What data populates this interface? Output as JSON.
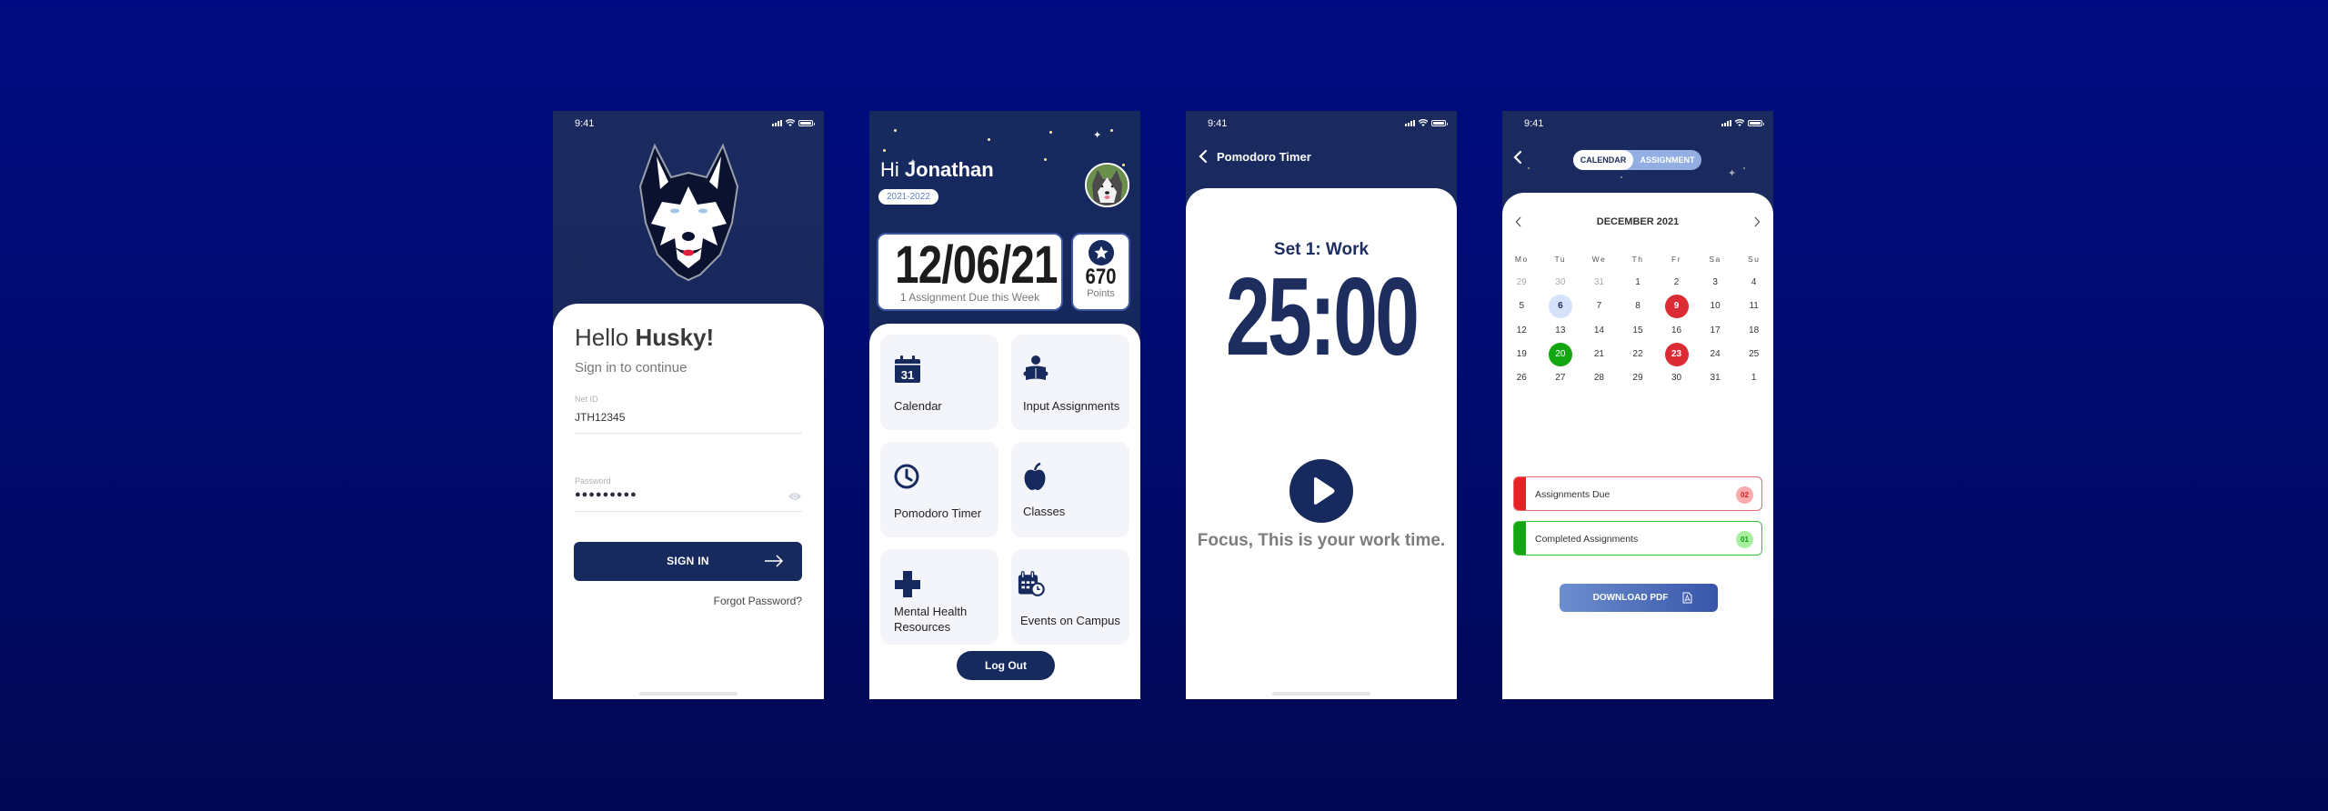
{
  "status_bar": {
    "time": "9:41"
  },
  "login": {
    "greeting_prefix": "Hello ",
    "greeting_name": "Husky!",
    "subtitle": "Sign in to continue",
    "netid_label": "Net ID",
    "netid_value": "JTH12345",
    "password_label": "Password",
    "password_value": "●●●●●●●●●",
    "signin_label": "SIGN IN",
    "forgot_label": "Forgot Password?"
  },
  "home": {
    "greeting_prefix": "Hi ",
    "greeting_name": "Jonathan",
    "academic_year": "2021-2022",
    "date": "12/06/21",
    "due_summary": "1 Assignment Due this Week",
    "points_value": "670",
    "points_label": "Points",
    "tiles": [
      {
        "label": "Calendar",
        "icon": "calendar-icon"
      },
      {
        "label": "Input Assignments",
        "icon": "reading-person-icon"
      },
      {
        "label": "Pomodoro Timer",
        "icon": "clock-icon"
      },
      {
        "label": "Classes",
        "icon": "apple-icon"
      },
      {
        "label": "Mental Health Resources",
        "icon": "medical-cross-icon"
      },
      {
        "label": "Events on Campus",
        "icon": "calendar-clock-icon"
      }
    ],
    "logout_label": "Log Out"
  },
  "pomodoro": {
    "title": "Pomodoro Timer",
    "set_label": "Set 1: Work",
    "timer": "25:00",
    "message": "Focus, This is your work time."
  },
  "calendar": {
    "tab_calendar": "CALENDAR",
    "tab_assignment": "ASSIGNMENT",
    "month_title": "DECEMBER 2021",
    "weekdays": [
      "Mo",
      "Tu",
      "We",
      "Th",
      "Fr",
      "Sa",
      "Su"
    ],
    "weeks": [
      [
        {
          "d": "29",
          "s": "muted"
        },
        {
          "d": "30",
          "s": "muted"
        },
        {
          "d": "31",
          "s": "muted"
        },
        {
          "d": "1"
        },
        {
          "d": "2"
        },
        {
          "d": "3"
        },
        {
          "d": "4"
        }
      ],
      [
        {
          "d": "5"
        },
        {
          "d": "6",
          "s": "sel"
        },
        {
          "d": "7"
        },
        {
          "d": "8"
        },
        {
          "d": "9",
          "s": "due"
        },
        {
          "d": "10"
        },
        {
          "d": "11"
        }
      ],
      [
        {
          "d": "12"
        },
        {
          "d": "13"
        },
        {
          "d": "14"
        },
        {
          "d": "15"
        },
        {
          "d": "16"
        },
        {
          "d": "17"
        },
        {
          "d": "18"
        }
      ],
      [
        {
          "d": "19"
        },
        {
          "d": "20",
          "s": "done"
        },
        {
          "d": "21"
        },
        {
          "d": "22"
        },
        {
          "d": "23",
          "s": "due"
        },
        {
          "d": "24"
        },
        {
          "d": "25"
        }
      ],
      [
        {
          "d": "26"
        },
        {
          "d": "27"
        },
        {
          "d": "28"
        },
        {
          "d": "29"
        },
        {
          "d": "30"
        },
        {
          "d": "31"
        },
        {
          "d": "1"
        }
      ]
    ],
    "due_label": "Assignments Due",
    "due_count": "02",
    "completed_label": "Completed Assignments",
    "completed_count": "01",
    "download_label": "DOWNLOAD PDF"
  },
  "colors": {
    "brand_navy": "#172a5e",
    "due_red": "#db2b34",
    "done_green": "#13a612",
    "selected_blue": "#d6e2fb"
  }
}
